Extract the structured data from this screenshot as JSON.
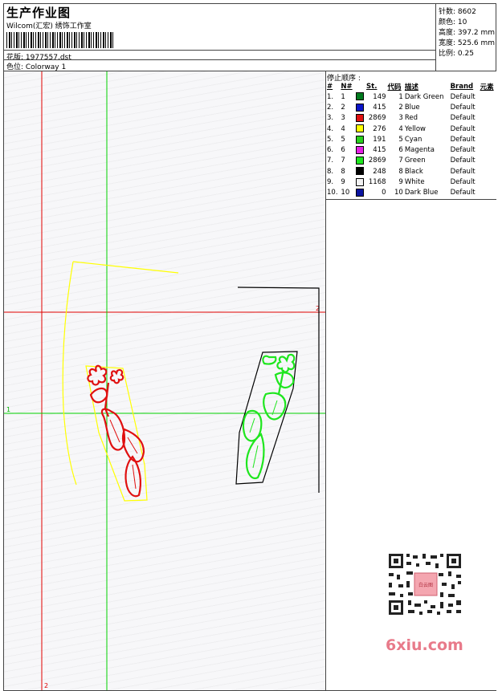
{
  "header": {
    "title": "生产作业图",
    "company": "Wilcom(汇宏) 绣饰工作室",
    "file_label": "花版: 1977557.dst",
    "colorway_label": "色位: Colorway 1",
    "stats": [
      "针数: 8602",
      "颜色: 10",
      "高度: 397.2 mm",
      "宽度: 525.6 mm",
      "比例: 0.25"
    ]
  },
  "stop_panel": {
    "title": "停止顺序 :",
    "columns": [
      "#",
      "N#",
      "St.",
      "代码",
      "描述",
      "Brand",
      "元素"
    ],
    "rows": [
      {
        "idx": "1.",
        "n": "1",
        "st": "149",
        "code": "1",
        "desc": "Dark Green",
        "brand": "Default",
        "color": "#007a1e"
      },
      {
        "idx": "2.",
        "n": "2",
        "st": "415",
        "code": "2",
        "desc": "Blue",
        "brand": "Default",
        "color": "#0a14c8"
      },
      {
        "idx": "3.",
        "n": "3",
        "st": "2869",
        "code": "3",
        "desc": "Red",
        "brand": "Default",
        "color": "#e01010"
      },
      {
        "idx": "4.",
        "n": "4",
        "st": "276",
        "code": "4",
        "desc": "Yellow",
        "brand": "Default",
        "color": "#ffff00"
      },
      {
        "idx": "5.",
        "n": "5",
        "st": "191",
        "code": "5",
        "desc": "Cyan",
        "brand": "Default",
        "color": "#2ad01e"
      },
      {
        "idx": "6.",
        "n": "6",
        "st": "415",
        "code": "6",
        "desc": "Magenta",
        "brand": "Default",
        "color": "#e61ee6"
      },
      {
        "idx": "7.",
        "n": "7",
        "st": "2869",
        "code": "7",
        "desc": "Green",
        "brand": "Default",
        "color": "#1ee61e"
      },
      {
        "idx": "8.",
        "n": "8",
        "st": "248",
        "code": "8",
        "desc": "Black",
        "brand": "Default",
        "color": "#000000"
      },
      {
        "idx": "9.",
        "n": "9",
        "st": "1168",
        "code": "9",
        "desc": "White",
        "brand": "Default",
        "color": "#f2f2f2"
      },
      {
        "idx": "10.",
        "n": "10",
        "st": "0",
        "code": "10",
        "desc": "Dark Blue",
        "brand": "Default",
        "color": "#0a14a0"
      }
    ]
  },
  "canvas": {
    "axis_labels": {
      "h_top": "2",
      "h_left": "1",
      "v_bottom": "2"
    },
    "colors": {
      "red_axis": "#e00000",
      "green_axis": "#00d000",
      "yellow": "#ffff00",
      "red": "#e01010",
      "green": "#1ee61e",
      "black": "#000000"
    }
  },
  "watermark": {
    "text": "6xiu.com",
    "qr_center": "白云图"
  }
}
